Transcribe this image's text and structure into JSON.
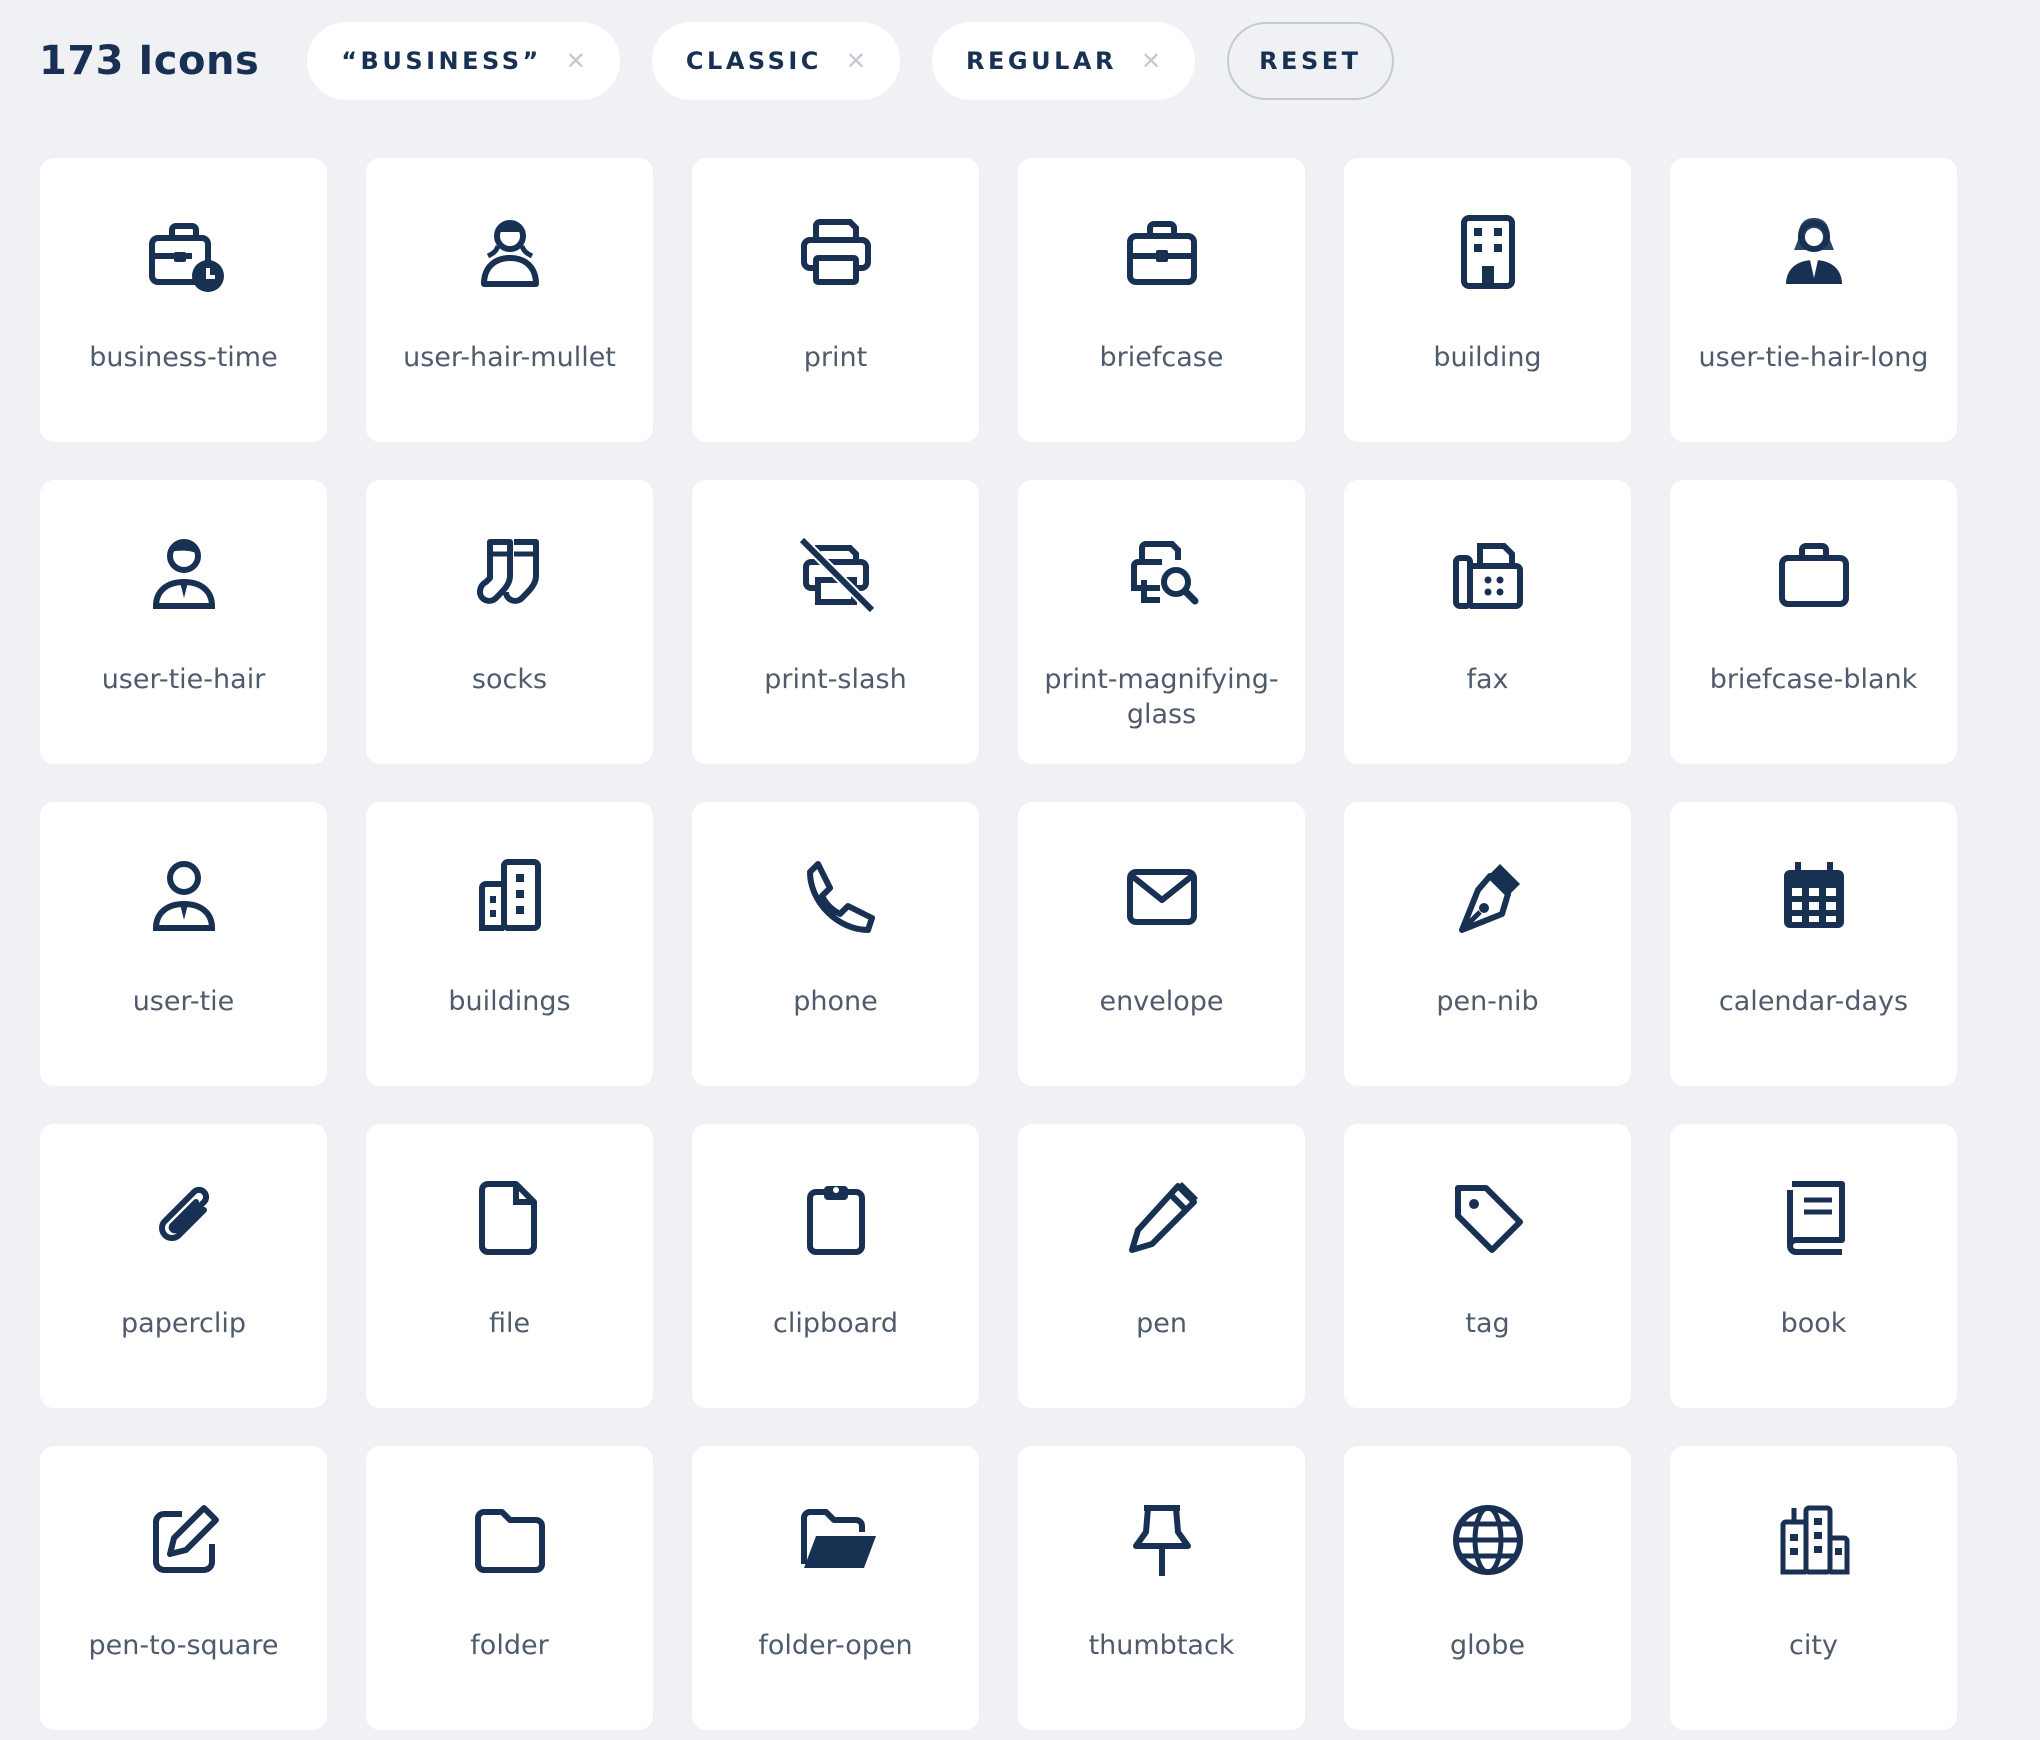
{
  "header": {
    "count_title": "173 Icons",
    "filters": [
      {
        "label": "“BUSINESS”",
        "remove_icon": "close-icon"
      },
      {
        "label": "CLASSIC",
        "remove_icon": "close-icon"
      },
      {
        "label": "REGULAR",
        "remove_icon": "close-icon"
      }
    ],
    "reset_label": "RESET"
  },
  "colors": {
    "background": "#f0f1f4",
    "card": "#ffffff",
    "icon": "#183153",
    "label": "#4f5b6d",
    "chip_close": "#c3c8d2"
  },
  "icons": [
    {
      "name": "business-time",
      "label": "business-time"
    },
    {
      "name": "user-hair-mullet",
      "label": "user-hair-mullet"
    },
    {
      "name": "print",
      "label": "print"
    },
    {
      "name": "briefcase",
      "label": "briefcase"
    },
    {
      "name": "building",
      "label": "building"
    },
    {
      "name": "user-tie-hair-long",
      "label": "user-tie-hair-long"
    },
    {
      "name": "user-tie-hair",
      "label": "user-tie-hair"
    },
    {
      "name": "socks",
      "label": "socks"
    },
    {
      "name": "print-slash",
      "label": "print-slash"
    },
    {
      "name": "print-magnifying-glass",
      "label": "print-magnifying-glass"
    },
    {
      "name": "fax",
      "label": "fax"
    },
    {
      "name": "briefcase-blank",
      "label": "briefcase-blank"
    },
    {
      "name": "user-tie",
      "label": "user-tie"
    },
    {
      "name": "buildings",
      "label": "buildings"
    },
    {
      "name": "phone",
      "label": "phone"
    },
    {
      "name": "envelope",
      "label": "envelope"
    },
    {
      "name": "pen-nib",
      "label": "pen-nib"
    },
    {
      "name": "calendar-days",
      "label": "calendar-days"
    },
    {
      "name": "paperclip",
      "label": "paperclip"
    },
    {
      "name": "file",
      "label": "file"
    },
    {
      "name": "clipboard",
      "label": "clipboard"
    },
    {
      "name": "pen",
      "label": "pen"
    },
    {
      "name": "tag",
      "label": "tag"
    },
    {
      "name": "book",
      "label": "book"
    },
    {
      "name": "pen-to-square",
      "label": "pen-to-square"
    },
    {
      "name": "folder",
      "label": "folder"
    },
    {
      "name": "folder-open",
      "label": "folder-open"
    },
    {
      "name": "thumbtack",
      "label": "thumbtack"
    },
    {
      "name": "globe",
      "label": "globe"
    },
    {
      "name": "city",
      "label": "city"
    }
  ]
}
